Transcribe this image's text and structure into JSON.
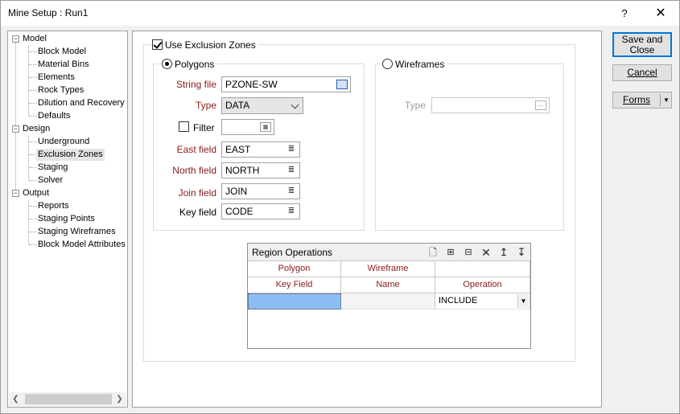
{
  "window": {
    "title": "Mine Setup : Run1",
    "help_label": "?",
    "close_label": "✕"
  },
  "tree": {
    "groups": [
      {
        "label": "Model",
        "items": [
          "Block Model",
          "Material Bins",
          "Elements",
          "Rock Types",
          "Dilution and Recovery",
          "Defaults"
        ]
      },
      {
        "label": "Design",
        "items": [
          "Underground",
          "Exclusion Zones",
          "Staging",
          "Solver"
        ]
      },
      {
        "label": "Output",
        "items": [
          "Reports",
          "Staging Points",
          "Staging Wireframes",
          "Block Model Attributes"
        ]
      }
    ],
    "selected": "Exclusion Zones"
  },
  "exclusion": {
    "use_label": "Use Exclusion Zones",
    "polygons": {
      "label": "Polygons",
      "string_file_label": "String file",
      "string_file_value": "PZONE-SW",
      "type_label": "Type",
      "type_value": "DATA",
      "filter_label": "Filter",
      "filter_value": "",
      "east_label": "East field",
      "east_value": "EAST",
      "north_label": "North field",
      "north_value": "NORTH",
      "join_label": "Join field",
      "join_value": "JOIN",
      "key_label": "Key field",
      "key_value": "CODE"
    },
    "wireframes": {
      "label": "Wireframes",
      "type_label": "Type",
      "type_value": ""
    }
  },
  "region_ops": {
    "title": "Region Operations",
    "header_groups": [
      "Polygon",
      "Wireframe",
      ""
    ],
    "columns": [
      "Key Field",
      "Name",
      "Operation"
    ],
    "rows": [
      {
        "key_field": "",
        "name": "",
        "operation": "INCLUDE"
      }
    ]
  },
  "buttons": {
    "save_close_line1": "Save and",
    "save_close_line2": "Close",
    "cancel": "Cancel",
    "forms": "Forms"
  }
}
